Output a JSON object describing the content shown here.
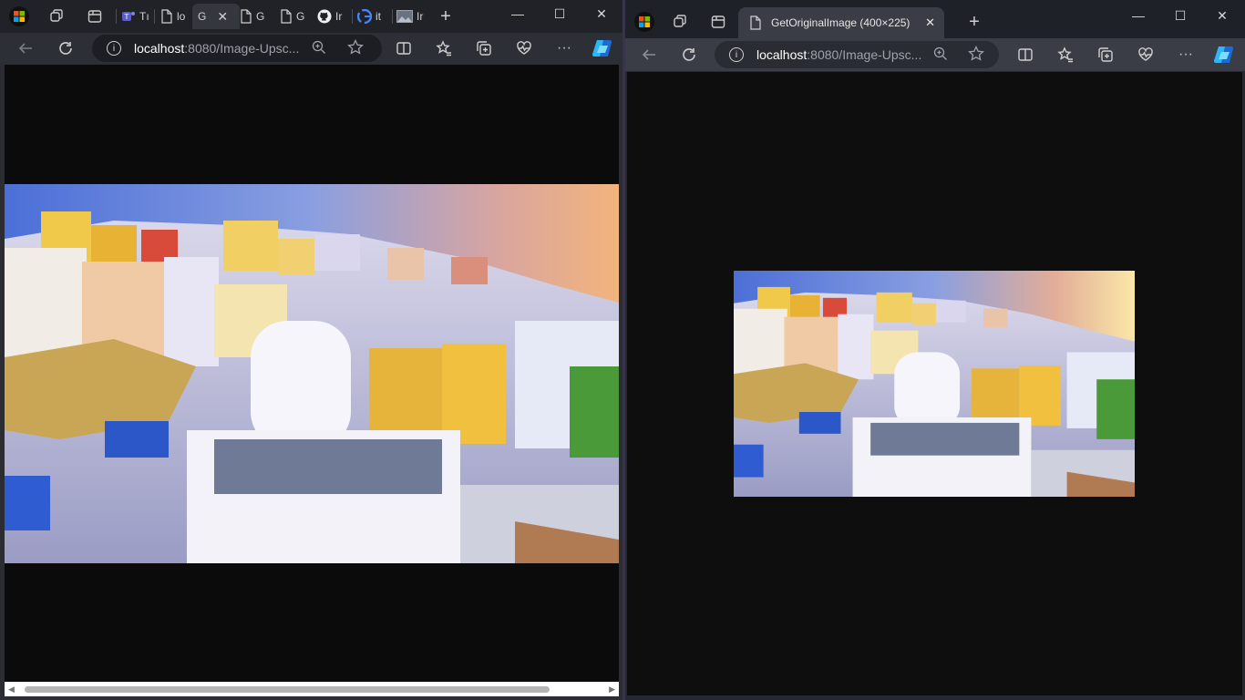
{
  "left_window": {
    "tabs": [
      {
        "label": "Tı",
        "icon": "teams-icon"
      },
      {
        "label": "lo",
        "icon": "page-icon"
      },
      {
        "label": "G",
        "icon": "page-icon",
        "active": true
      },
      {
        "label": "G",
        "icon": "page-icon"
      },
      {
        "label": "G",
        "icon": "page-icon"
      },
      {
        "label": "Ir",
        "icon": "github-icon"
      },
      {
        "label": "it",
        "icon": "google-icon"
      },
      {
        "label": "Ir",
        "icon": "image-icon"
      }
    ],
    "address": {
      "host": "localhost",
      "rest": ":8080/Image-Upsc..."
    }
  },
  "right_window": {
    "active_tab_title": "GetOriginalImage (400×225)",
    "address": {
      "host": "localhost",
      "rest": ":8080/Image-Upsc..."
    }
  },
  "colors": {
    "viewport_bg": "#0b0b0c",
    "tabstrip_bg": "#202228",
    "copilot": "#2db7f5"
  }
}
